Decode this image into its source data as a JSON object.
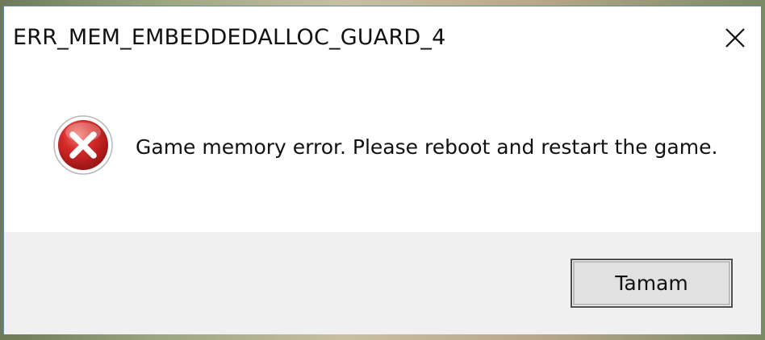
{
  "dialog": {
    "title": "ERR_MEM_EMBEDDEDALLOC_GUARD_4",
    "close_icon": "close-icon",
    "error_icon": "error-icon",
    "message": "Game memory error. Please reboot and restart the game.",
    "ok_label": "Tamam"
  },
  "colors": {
    "error_red": "#d62a2a",
    "footer_bg": "#f0f0f0",
    "border": "#5c8ab8"
  }
}
